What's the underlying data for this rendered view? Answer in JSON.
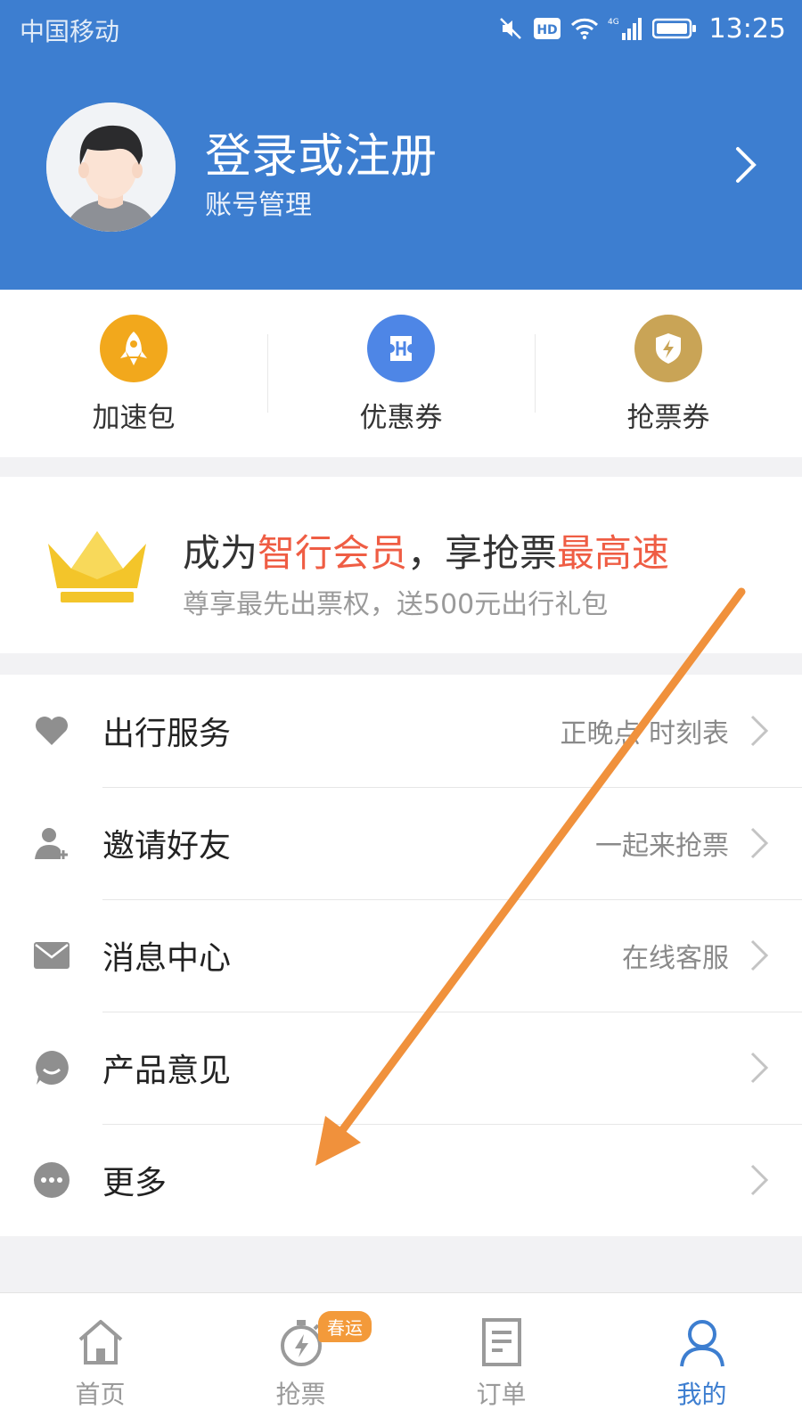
{
  "status_bar": {
    "carrier": "中国移动",
    "network_badge": "HD",
    "signal_type": "4G",
    "time": "13:25",
    "icons": [
      "mute-icon",
      "hd-icon",
      "wifi-icon",
      "signal-icon",
      "battery-icon"
    ]
  },
  "profile": {
    "title": "登录或注册",
    "subtitle": "账号管理"
  },
  "quick_actions": [
    {
      "label": "加速包",
      "icon": "rocket-icon",
      "color": "#f2a81c"
    },
    {
      "label": "优惠券",
      "icon": "ticket-icon",
      "color": "#4e86e6"
    },
    {
      "label": "抢票券",
      "icon": "shield-bolt-icon",
      "color": "#c9a456"
    }
  ],
  "member": {
    "title_prefix": "成为",
    "title_highlight1": "智行会员",
    "title_mid": "，享抢票",
    "title_highlight2": "最高速",
    "subtitle": "尊享最先出票权，送500元出行礼包",
    "highlight_color": "#ef5d44"
  },
  "menu": [
    {
      "label": "出行服务",
      "value": "正晚点 时刻表",
      "icon": "heart-icon"
    },
    {
      "label": "邀请好友",
      "value": "一起来抢票",
      "icon": "add-user-icon"
    },
    {
      "label": "消息中心",
      "value": "在线客服",
      "icon": "mail-icon"
    },
    {
      "label": "产品意见",
      "value": "",
      "icon": "feedback-icon"
    },
    {
      "label": "更多",
      "value": "",
      "icon": "more-icon"
    }
  ],
  "bottom_nav": [
    {
      "label": "首页",
      "icon": "home-icon"
    },
    {
      "label": "抢票",
      "icon": "stopwatch-icon",
      "badge": "春运"
    },
    {
      "label": "订单",
      "icon": "order-icon"
    },
    {
      "label": "我的",
      "icon": "user-icon",
      "active": true
    }
  ],
  "colors": {
    "header_blue": "#3d7ed0",
    "annotation_orange": "#f0913c"
  }
}
